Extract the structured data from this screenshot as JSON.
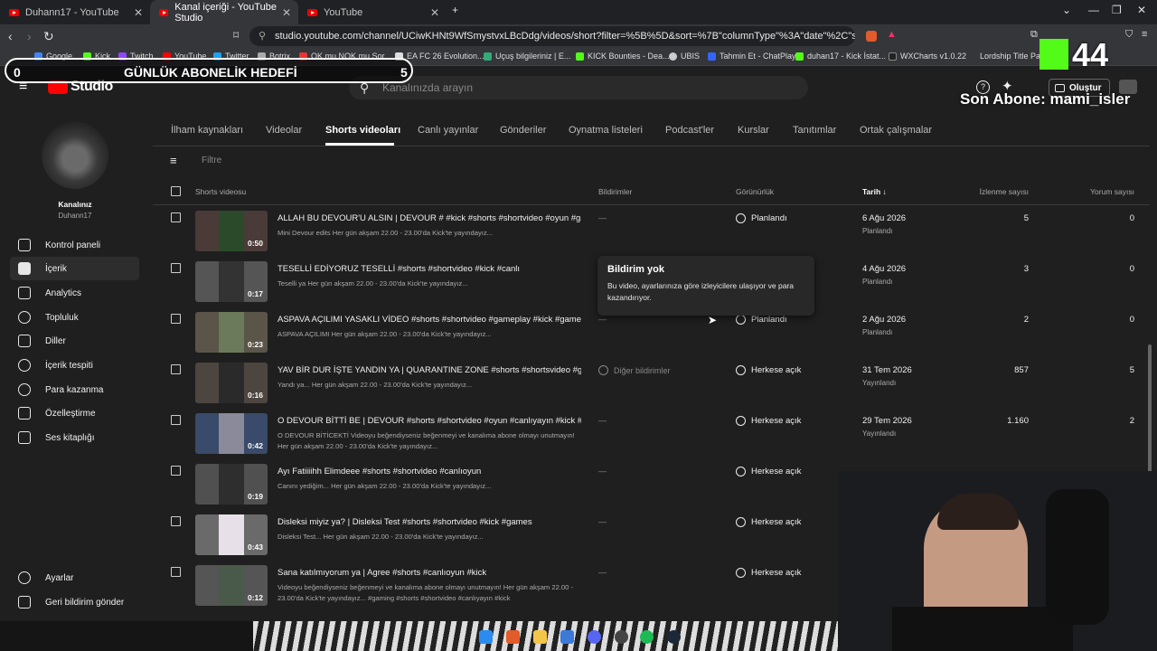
{
  "browser": {
    "tabs": [
      {
        "label": "Duhann17 - YouTube",
        "active": false
      },
      {
        "label": "Kanal içeriği - YouTube Studio",
        "active": true
      },
      {
        "label": "YouTube",
        "active": false
      }
    ],
    "url": "studio.youtube.com/channel/UCiwKHNt9WfSmystvxLBcDdg/videos/short?filter=%5B%5D&sort=%7B\"columnType\"%3A\"date\"%2C\"sortOrder\"%3A\"DESC...",
    "bookmarks": [
      "Google",
      "Kick",
      "Twitch",
      "YouTube",
      "Twitter",
      "Botrix",
      "OK mu NOK mu Sor...",
      "EA FC 26 Evolution...",
      "Uçuş bilgileriniz | E...",
      "KICK Bounties - Dea...",
      "UBIS",
      "Tahmin Et - ChatPlay",
      "duhan17 - Kick İstat...",
      "WXCharts v1.0.22",
      "Lordship Title Pack"
    ]
  },
  "overlay": {
    "goal_title": "GÜNLÜK ABONELİK HEDEFİ",
    "goal_current": "0",
    "goal_target": "5",
    "last_sub": "Son Abone: mami_isler",
    "counter": "44"
  },
  "studio": {
    "logo": "Studio",
    "search_placeholder": "Kanalınızda arayın",
    "create_label": "Oluştur"
  },
  "sidebar": {
    "channel_label": "Kanalınız",
    "channel_name": "Duhann17",
    "items": [
      {
        "label": "Kontrol paneli"
      },
      {
        "label": "İçerik"
      },
      {
        "label": "Analytics"
      },
      {
        "label": "Topluluk"
      },
      {
        "label": "Diller"
      },
      {
        "label": "İçerik tespiti"
      },
      {
        "label": "Para kazanma"
      },
      {
        "label": "Özelleştirme"
      },
      {
        "label": "Ses kitaplığı"
      }
    ],
    "bottom": [
      {
        "label": "Ayarlar"
      },
      {
        "label": "Geri bildirim gönder"
      }
    ]
  },
  "tabs": [
    "İlham kaynakları",
    "Videolar",
    "Shorts videoları",
    "Canlı yayınlar",
    "Gönderiler",
    "Oynatma listeleri",
    "Podcast'ler",
    "Kurslar",
    "Tanıtımlar",
    "Ortak çalışmalar"
  ],
  "filter_label": "Filtre",
  "columns": {
    "video": "Shorts videosu",
    "notif": "Bildirimler",
    "vis": "Görünürlük",
    "date": "Tarih",
    "views": "İzlenme sayısı",
    "comments": "Yorum sayısı"
  },
  "tooltip": {
    "title": "Bildirim yok",
    "body": "Bu video, ayarlarınıza göre izleyicilere ulaşıyor ve para kazandırıyor."
  },
  "rows": [
    {
      "title": "ALLAH BU DEVOUR'U ALSIN | DEVOUR # #kick #shorts #shortvideo #oyun #ga...",
      "desc": "Mini Devour edits Her gün akşam 22.00 - 23.00'da Kick'te yayındayız...",
      "duration": "0:50",
      "notif": "—",
      "visibility": "Planlandı",
      "date": "6 Ağu 2026",
      "date_status": "Planlandı",
      "views": "5",
      "comments": "0"
    },
    {
      "title": "TESELLİ EDİYORUZ TESELLİ #shorts #shortvideo #kick #canlı",
      "desc": "Teselli ya Her gün akşam 22.00 - 23.00'da Kick'te yayındayız...",
      "duration": "0:17",
      "notif": "",
      "visibility": "",
      "date": "4 Ağu 2026",
      "date_status": "Planlandı",
      "views": "3",
      "comments": "0"
    },
    {
      "title": "ASPAVA AÇILIMI YASAKLI VİDEO #shorts #shortvideo #gameplay #kick #games",
      "desc": "ASPAVA AÇILIMI Her gün akşam 22.00 - 23.00'da Kick'te yayındayız...",
      "duration": "0:23",
      "notif": "—",
      "visibility": "Planlandı",
      "date": "2 Ağu 2026",
      "date_status": "Planlandı",
      "views": "2",
      "comments": "0"
    },
    {
      "title": "YAV BİR DUR İŞTE YANDIN YA | QUARANTINE ZONE #shorts #shortsvideo #ga...",
      "desc": "Yandı ya... Her gün akşam 22.00 - 23.00'da Kick'te yayındayız...",
      "duration": "0:16",
      "notif": "Diğer bildirimler",
      "visibility": "Herkese açık",
      "date": "31 Tem 2026",
      "date_status": "Yayınlandı",
      "views": "857",
      "comments": "5"
    },
    {
      "title": "O DEVOUR BİTTİ BE | DEVOUR #shorts #shortvideo #oyun #canlıyayın #kick #d...",
      "desc": "O DEVOUR BİTİCEKTİ Videoyu beğendiyseniz beğenmeyi ve kanalıma abone olmayı unutmayın! Her gün akşam 22.00 - 23.00'da Kick'te yayındayız...",
      "duration": "0:42",
      "notif": "—",
      "visibility": "Herkese açık",
      "date": "29 Tem 2026",
      "date_status": "Yayınlandı",
      "views": "1.160",
      "comments": "2"
    },
    {
      "title": "Ayı Fatiiiihh Elimdeee #shorts #shortvideo #canlıoyun",
      "desc": "Canını yediğim... Her gün akşam 22.00 - 23.00'da Kick'te yayındayız...",
      "duration": "0:19",
      "notif": "—",
      "visibility": "Herkese açık",
      "date": "",
      "date_status": "",
      "views": "",
      "comments": ""
    },
    {
      "title": "Disleksi miyiz ya? | Disleksi Test #shorts #shortvideo #kick #games",
      "desc": "Disleksi Test... Her gün akşam 22.00 - 23.00'da Kick'te yayındayız...",
      "duration": "0:43",
      "notif": "—",
      "visibility": "Herkese açık",
      "date": "",
      "date_status": "",
      "views": "",
      "comments": ""
    },
    {
      "title": "Sana katılmıyorum ya | Agree #shorts #canlıoyun #kick",
      "desc": "Videoyu beğendiyseniz beğenmeyi ve kanalıma abone olmayı unutmayın! Her gün akşam 22.00 - 23.00'da Kick'te yayındayız... #gaming #shorts #shortvideo #canlıyayın #kick",
      "duration": "0:12",
      "notif": "—",
      "visibility": "Herkese açık",
      "date": "",
      "date_status": "",
      "views": "",
      "comments": ""
    }
  ]
}
